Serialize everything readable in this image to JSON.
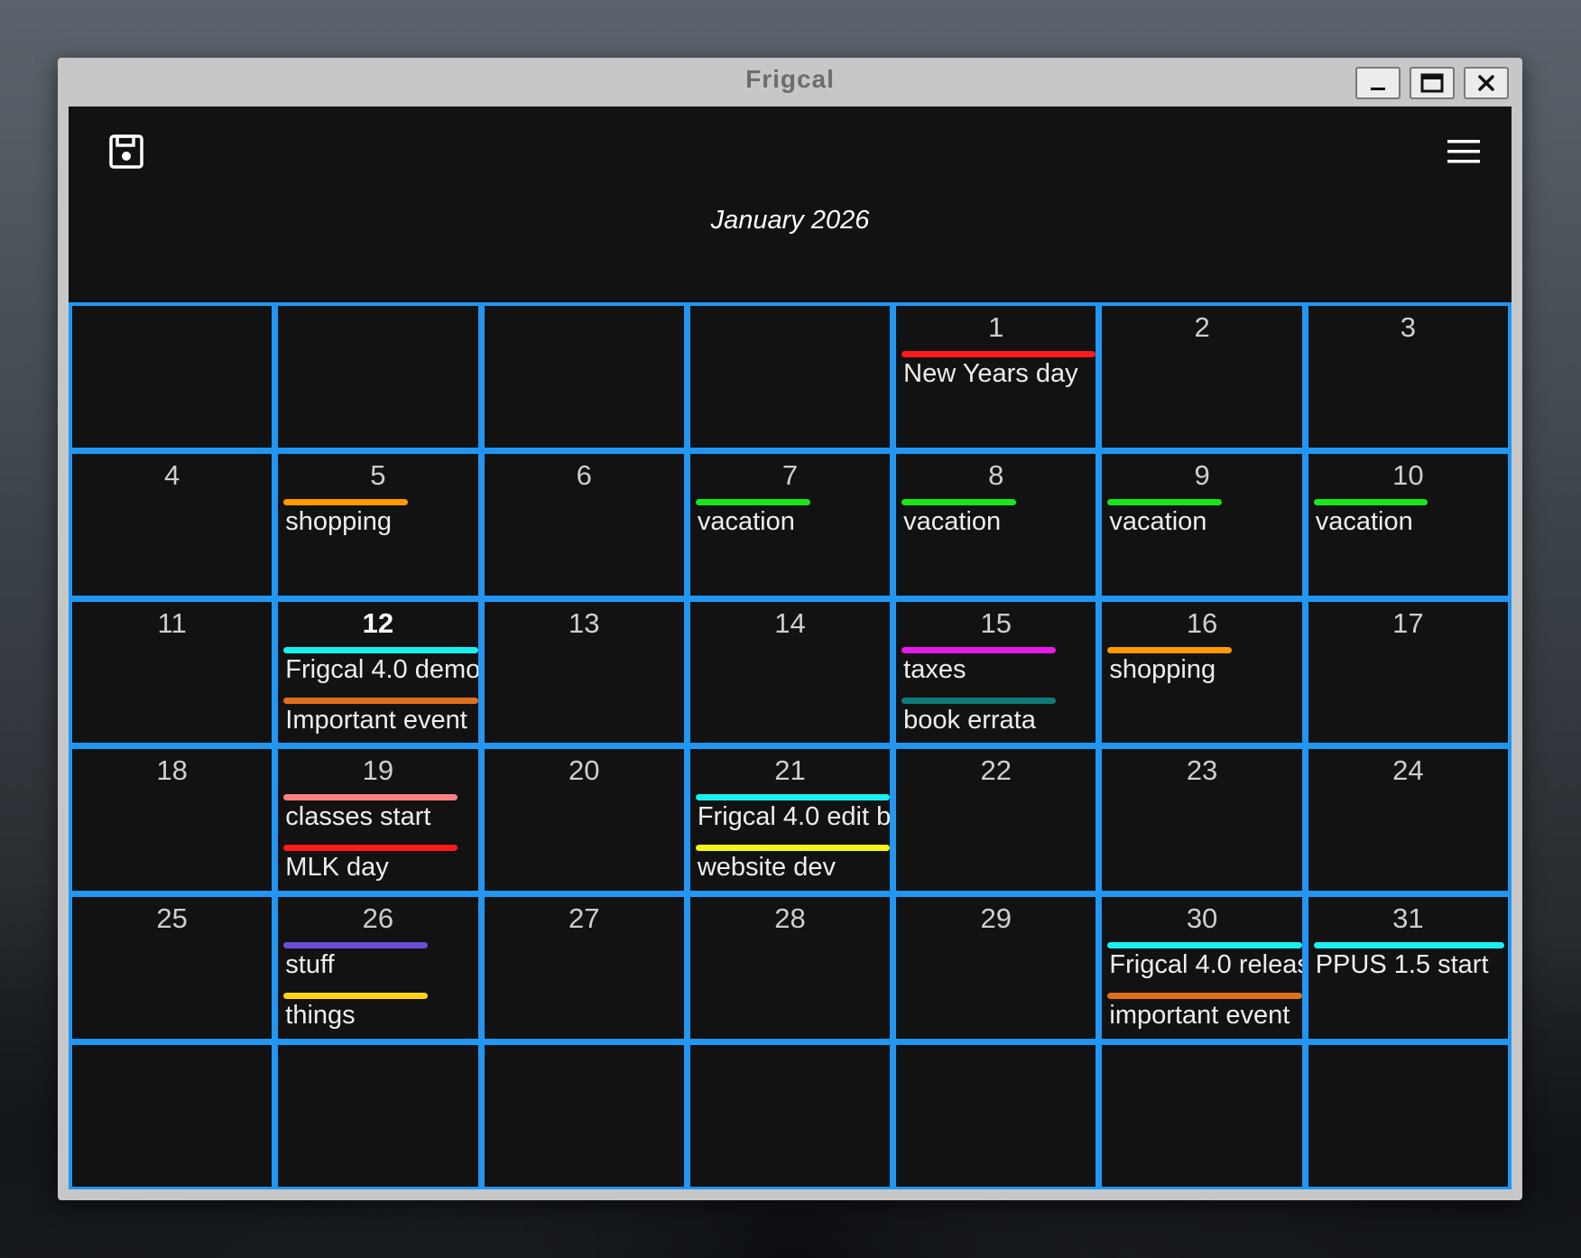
{
  "window": {
    "title": "Frigcal",
    "controls": [
      "minimize-icon",
      "maximize-icon",
      "close-icon"
    ]
  },
  "toolbar": {
    "save_icon": "save-icon",
    "menu_icon": "hamburger-menu-icon"
  },
  "calendar": {
    "month_label": "January 2026",
    "today": "12",
    "colors": {
      "grid": "#2196f3",
      "background": "#121212"
    },
    "weeks": [
      [
        {
          "day": ""
        },
        {
          "day": ""
        },
        {
          "day": ""
        },
        {
          "day": ""
        },
        {
          "day": "1",
          "events": [
            {
              "label": "New Years day",
              "color": "#ff1a1a",
              "bar": 1.0
            }
          ]
        },
        {
          "day": "2"
        },
        {
          "day": "3"
        }
      ],
      [
        {
          "day": "4"
        },
        {
          "day": "5",
          "events": [
            {
              "label": "shopping",
              "color": "#ff9900",
              "bar": 0.65
            }
          ]
        },
        {
          "day": "6"
        },
        {
          "day": "7",
          "events": [
            {
              "label": "vacation",
              "color": "#19e619",
              "bar": 0.6
            }
          ]
        },
        {
          "day": "8",
          "events": [
            {
              "label": "vacation",
              "color": "#19e619",
              "bar": 0.6
            }
          ]
        },
        {
          "day": "9",
          "events": [
            {
              "label": "vacation",
              "color": "#19e619",
              "bar": 0.6
            }
          ]
        },
        {
          "day": "10",
          "events": [
            {
              "label": "vacation",
              "color": "#19e619",
              "bar": 0.6
            }
          ]
        }
      ],
      [
        {
          "day": "11"
        },
        {
          "day": "12",
          "events": [
            {
              "label": "Frigcal 4.0 demo",
              "color": "#19f0f0",
              "bar": 1.0
            },
            {
              "label": "Important event",
              "color": "#e0701c",
              "bar": 1.0
            }
          ]
        },
        {
          "day": "13"
        },
        {
          "day": "14"
        },
        {
          "day": "15",
          "events": [
            {
              "label": "taxes",
              "color": "#e619e6",
              "bar": 0.8
            },
            {
              "label": "book errata",
              "color": "#0f7a7a",
              "bar": 0.8
            }
          ]
        },
        {
          "day": "16",
          "events": [
            {
              "label": "shopping",
              "color": "#ff9900",
              "bar": 0.65
            }
          ]
        },
        {
          "day": "17"
        }
      ],
      [
        {
          "day": "18"
        },
        {
          "day": "19",
          "events": [
            {
              "label": "classes start",
              "color": "#ff8080",
              "bar": 0.9
            },
            {
              "label": "MLK day",
              "color": "#ff1a1a",
              "bar": 0.9
            }
          ]
        },
        {
          "day": "20"
        },
        {
          "day": "21",
          "events": [
            {
              "label": "Frigcal 4.0  edit b",
              "color": "#19f0f0",
              "bar": 1.0
            },
            {
              "label": "website dev",
              "color": "#f5f518",
              "bar": 1.0
            }
          ]
        },
        {
          "day": "22"
        },
        {
          "day": "23"
        },
        {
          "day": "24"
        }
      ],
      [
        {
          "day": "25"
        },
        {
          "day": "26",
          "events": [
            {
              "label": "stuff",
              "color": "#6a4cd6",
              "bar": 0.75
            },
            {
              "label": "things",
              "color": "#ffd21a",
              "bar": 0.75
            }
          ]
        },
        {
          "day": "27"
        },
        {
          "day": "28"
        },
        {
          "day": "29"
        },
        {
          "day": "30",
          "events": [
            {
              "label": "Frigcal 4.0 releas",
              "color": "#19f0f0",
              "bar": 1.0
            },
            {
              "label": "important event",
              "color": "#e0701c",
              "bar": 1.0
            }
          ]
        },
        {
          "day": "31",
          "events": [
            {
              "label": "PPUS 1.5 start",
              "color": "#19f0f0",
              "bar": 0.98
            }
          ]
        }
      ],
      [
        {
          "day": ""
        },
        {
          "day": ""
        },
        {
          "day": ""
        },
        {
          "day": ""
        },
        {
          "day": ""
        },
        {
          "day": ""
        },
        {
          "day": ""
        }
      ]
    ]
  }
}
